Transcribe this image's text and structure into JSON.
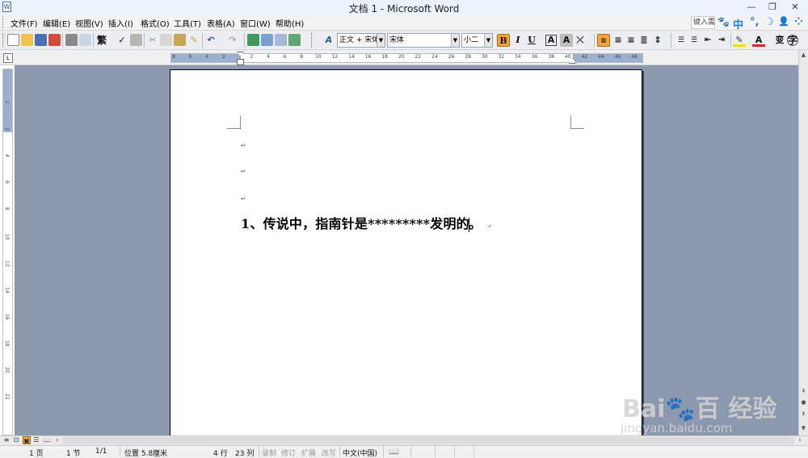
{
  "window": {
    "title": "文档 1 - Microsoft Word",
    "app_icon": "word-doc-icon"
  },
  "window_controls": {
    "minimize": "—",
    "restore": "❐",
    "close": "✕"
  },
  "menubar": {
    "items": [
      "文件(F)",
      "编辑(E)",
      "视图(V)",
      "插入(I)",
      "格式(O)",
      "工具(T)",
      "表格(A)",
      "窗口(W)",
      "帮助(H)"
    ],
    "help_box": "键入需要帮助的问题",
    "ime": {
      "paw": "🐾",
      "mode": "中",
      "punct": "°,",
      "moon": "☽",
      "user": "👤",
      "grid": "⁘"
    }
  },
  "toolbar": {
    "style_combo": "正文 + 宋体",
    "font_combo": "宋体",
    "size_combo": "小二",
    "bold": "B",
    "italic": "I",
    "underline": "U",
    "char_border": "A",
    "char_shading": "A",
    "font_color": "A",
    "phonetic": "变"
  },
  "ruler": {
    "tab_selector": "L",
    "h_numbers": [
      "8",
      "6",
      "4",
      "2",
      "2",
      "4",
      "6",
      "8",
      "10",
      "12",
      "14",
      "16",
      "18",
      "20",
      "22",
      "24",
      "26",
      "28",
      "30",
      "32",
      "34",
      "36",
      "38",
      "40",
      "42",
      "44",
      "46",
      "48"
    ],
    "v_numbers": [
      "2",
      "2",
      "4",
      "6",
      "8",
      "10",
      "12",
      "14",
      "16",
      "18",
      "20",
      "22"
    ]
  },
  "document": {
    "paragraph_mark": "↵",
    "question_text": "1、传说中，指南针是*********发明的",
    "question_end": "。"
  },
  "statusbar": {
    "page": "1 页",
    "section": "1 节",
    "page_of": "1/1",
    "position": "位置 5.8厘米",
    "line": "4 行",
    "column": "23 列",
    "rec": "录制",
    "trk": "修订",
    "ext": "扩展",
    "ovr": "改写",
    "language": "中文(中国)",
    "spell_icon": "📖"
  },
  "watermark": {
    "brand": "Bai🐾百 经验",
    "url": "jingyan.baidu.com"
  },
  "colors": {
    "canvas": "#8c98ae",
    "ruler_margin": "#9bb0cf",
    "accent": "#f7a23b",
    "ime_blue": "#1d7ee8"
  }
}
